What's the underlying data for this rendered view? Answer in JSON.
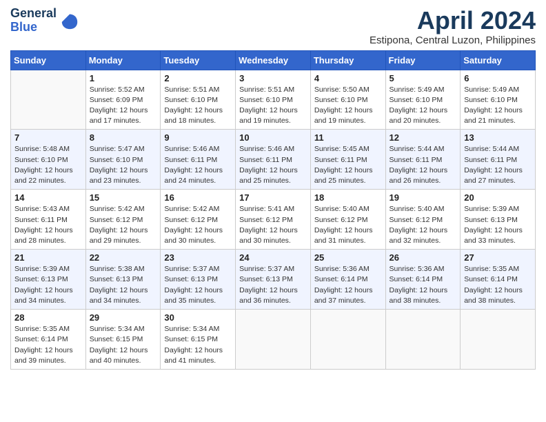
{
  "header": {
    "logo_line1": "General",
    "logo_line2": "Blue",
    "month_title": "April 2024",
    "location": "Estipona, Central Luzon, Philippines"
  },
  "weekdays": [
    "Sunday",
    "Monday",
    "Tuesday",
    "Wednesday",
    "Thursday",
    "Friday",
    "Saturday"
  ],
  "weeks": [
    [
      {
        "day": "",
        "info": ""
      },
      {
        "day": "1",
        "info": "Sunrise: 5:52 AM\nSunset: 6:09 PM\nDaylight: 12 hours\nand 17 minutes."
      },
      {
        "day": "2",
        "info": "Sunrise: 5:51 AM\nSunset: 6:10 PM\nDaylight: 12 hours\nand 18 minutes."
      },
      {
        "day": "3",
        "info": "Sunrise: 5:51 AM\nSunset: 6:10 PM\nDaylight: 12 hours\nand 19 minutes."
      },
      {
        "day": "4",
        "info": "Sunrise: 5:50 AM\nSunset: 6:10 PM\nDaylight: 12 hours\nand 19 minutes."
      },
      {
        "day": "5",
        "info": "Sunrise: 5:49 AM\nSunset: 6:10 PM\nDaylight: 12 hours\nand 20 minutes."
      },
      {
        "day": "6",
        "info": "Sunrise: 5:49 AM\nSunset: 6:10 PM\nDaylight: 12 hours\nand 21 minutes."
      }
    ],
    [
      {
        "day": "7",
        "info": "Sunrise: 5:48 AM\nSunset: 6:10 PM\nDaylight: 12 hours\nand 22 minutes."
      },
      {
        "day": "8",
        "info": "Sunrise: 5:47 AM\nSunset: 6:10 PM\nDaylight: 12 hours\nand 23 minutes."
      },
      {
        "day": "9",
        "info": "Sunrise: 5:46 AM\nSunset: 6:11 PM\nDaylight: 12 hours\nand 24 minutes."
      },
      {
        "day": "10",
        "info": "Sunrise: 5:46 AM\nSunset: 6:11 PM\nDaylight: 12 hours\nand 25 minutes."
      },
      {
        "day": "11",
        "info": "Sunrise: 5:45 AM\nSunset: 6:11 PM\nDaylight: 12 hours\nand 25 minutes."
      },
      {
        "day": "12",
        "info": "Sunrise: 5:44 AM\nSunset: 6:11 PM\nDaylight: 12 hours\nand 26 minutes."
      },
      {
        "day": "13",
        "info": "Sunrise: 5:44 AM\nSunset: 6:11 PM\nDaylight: 12 hours\nand 27 minutes."
      }
    ],
    [
      {
        "day": "14",
        "info": "Sunrise: 5:43 AM\nSunset: 6:11 PM\nDaylight: 12 hours\nand 28 minutes."
      },
      {
        "day": "15",
        "info": "Sunrise: 5:42 AM\nSunset: 6:12 PM\nDaylight: 12 hours\nand 29 minutes."
      },
      {
        "day": "16",
        "info": "Sunrise: 5:42 AM\nSunset: 6:12 PM\nDaylight: 12 hours\nand 30 minutes."
      },
      {
        "day": "17",
        "info": "Sunrise: 5:41 AM\nSunset: 6:12 PM\nDaylight: 12 hours\nand 30 minutes."
      },
      {
        "day": "18",
        "info": "Sunrise: 5:40 AM\nSunset: 6:12 PM\nDaylight: 12 hours\nand 31 minutes."
      },
      {
        "day": "19",
        "info": "Sunrise: 5:40 AM\nSunset: 6:12 PM\nDaylight: 12 hours\nand 32 minutes."
      },
      {
        "day": "20",
        "info": "Sunrise: 5:39 AM\nSunset: 6:13 PM\nDaylight: 12 hours\nand 33 minutes."
      }
    ],
    [
      {
        "day": "21",
        "info": "Sunrise: 5:39 AM\nSunset: 6:13 PM\nDaylight: 12 hours\nand 34 minutes."
      },
      {
        "day": "22",
        "info": "Sunrise: 5:38 AM\nSunset: 6:13 PM\nDaylight: 12 hours\nand 34 minutes."
      },
      {
        "day": "23",
        "info": "Sunrise: 5:37 AM\nSunset: 6:13 PM\nDaylight: 12 hours\nand 35 minutes."
      },
      {
        "day": "24",
        "info": "Sunrise: 5:37 AM\nSunset: 6:13 PM\nDaylight: 12 hours\nand 36 minutes."
      },
      {
        "day": "25",
        "info": "Sunrise: 5:36 AM\nSunset: 6:14 PM\nDaylight: 12 hours\nand 37 minutes."
      },
      {
        "day": "26",
        "info": "Sunrise: 5:36 AM\nSunset: 6:14 PM\nDaylight: 12 hours\nand 38 minutes."
      },
      {
        "day": "27",
        "info": "Sunrise: 5:35 AM\nSunset: 6:14 PM\nDaylight: 12 hours\nand 38 minutes."
      }
    ],
    [
      {
        "day": "28",
        "info": "Sunrise: 5:35 AM\nSunset: 6:14 PM\nDaylight: 12 hours\nand 39 minutes."
      },
      {
        "day": "29",
        "info": "Sunrise: 5:34 AM\nSunset: 6:15 PM\nDaylight: 12 hours\nand 40 minutes."
      },
      {
        "day": "30",
        "info": "Sunrise: 5:34 AM\nSunset: 6:15 PM\nDaylight: 12 hours\nand 41 minutes."
      },
      {
        "day": "",
        "info": ""
      },
      {
        "day": "",
        "info": ""
      },
      {
        "day": "",
        "info": ""
      },
      {
        "day": "",
        "info": ""
      }
    ]
  ]
}
